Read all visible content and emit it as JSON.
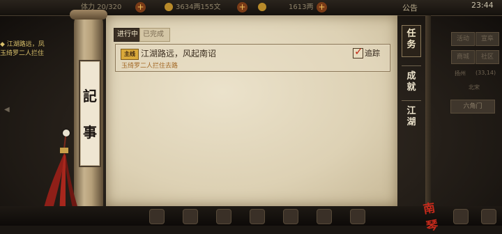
{
  "topbar": {
    "level_text": "体力 20/320",
    "currency1": "3634两155文",
    "currency2": "1613两",
    "notice": "公告",
    "clock": "23:44"
  },
  "left_hint": {
    "line1": "◆ 江湖路远，凤",
    "line2": "玉绮罗二人拦住"
  },
  "right_panel": {
    "buttons": [
      "活动",
      "宣阜",
      "商城",
      "社区"
    ],
    "location": "扬州",
    "coords": "(33,14)",
    "sub": "北宋",
    "gate": "六角门"
  },
  "scroll": {
    "label_chars": [
      "記",
      "事"
    ]
  },
  "tabs": {
    "active": "进行中",
    "idle": "已完成"
  },
  "quest": {
    "badge": "主线",
    "title": "江湖路远，风起南诏",
    "subtitle": "玉绮罗二人拦住去路",
    "track_label": "追踪",
    "tracked": true
  },
  "side_tabs": [
    {
      "label_lines": [
        "任",
        "务"
      ],
      "active": true
    },
    {
      "label_lines": [
        "成",
        "就"
      ],
      "active": false
    },
    {
      "label_lines": [
        "江",
        "湖"
      ],
      "active": false
    }
  ],
  "stamp": "南琴",
  "colors": {
    "accent_red": "#c22a16",
    "tab_active_bg": "#3a2f24",
    "subtitle_orange": "#a36825",
    "badge_gold": "#d9a93a"
  }
}
